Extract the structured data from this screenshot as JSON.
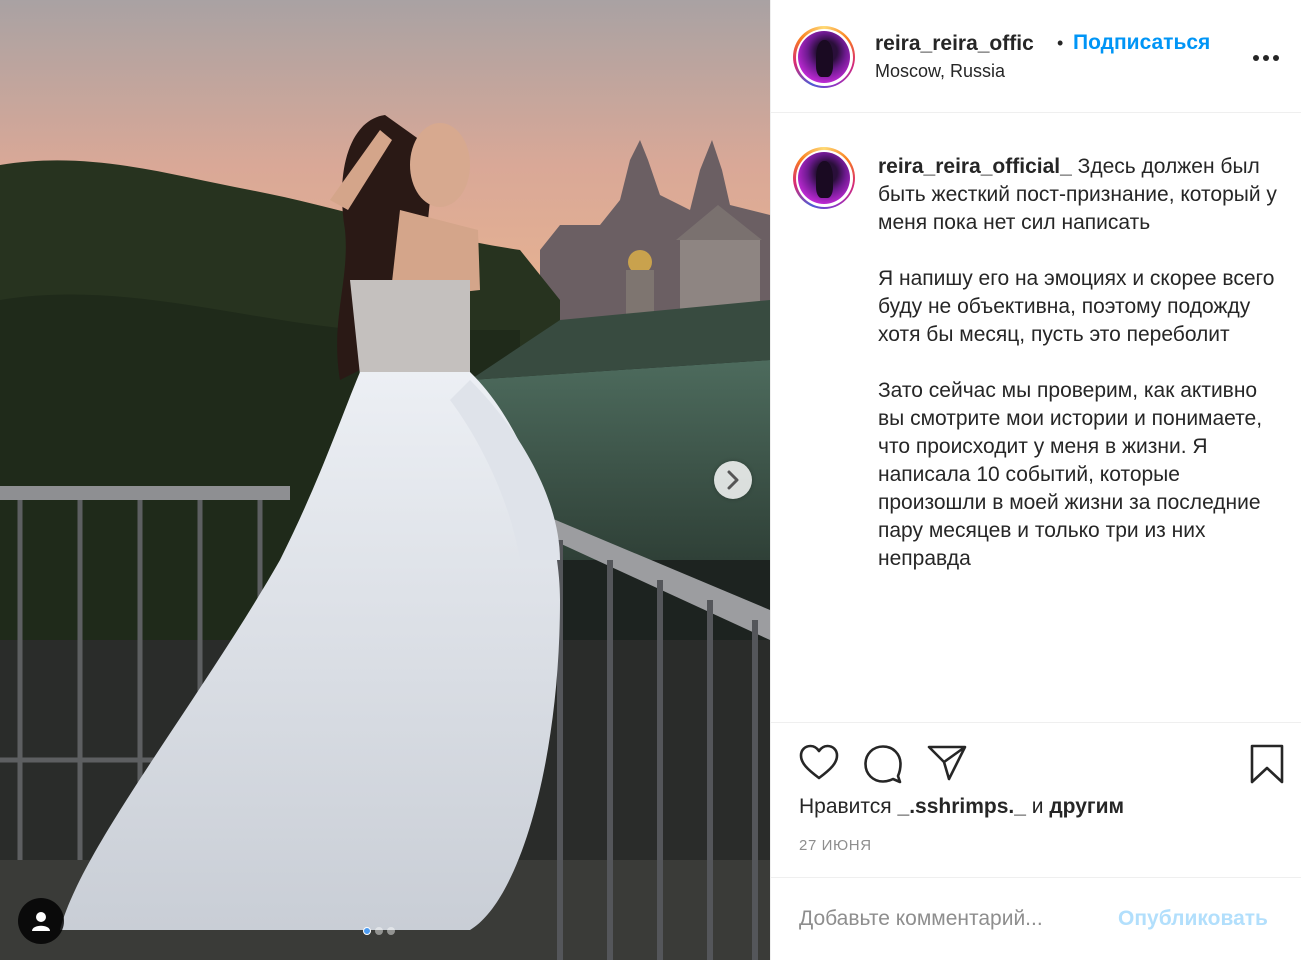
{
  "post": {
    "username": "reira_reira_offic",
    "separator": "•",
    "follow_label": "Подписаться",
    "location": "Moscow, Russia",
    "more_icon": "more-horizontal-icon"
  },
  "caption": {
    "username": "reira_reira_official_",
    "text": "Здесь должен был быть жесткий пост-признание, который у меня пока нет сил написать\n\nЯ напишу его на эмоциях и скорее всего буду не объективна, поэтому подожду хотя бы месяц, пусть это переболит\n\nЗато сейчас мы проверим, как активно вы смотрите мои истории и понимаете, что происходит у меня в жизни. Я написала 10 событий, которые произошли в моей жизни за последние пару месяцев и только три из них неправда"
  },
  "likes": {
    "prefix": "Нравится",
    "user": "_.sshrimps._",
    "conjunction": "и",
    "others": "другим"
  },
  "date": "27 ИЮНЯ",
  "comment": {
    "placeholder": "Добавьте комментарий...",
    "publish_label": "Опубликовать"
  },
  "carousel": {
    "slides": 3,
    "active_slide": 1
  },
  "colors": {
    "accent": "#0095f6",
    "publish_disabled": "#b2dffc",
    "muted": "#8e8e8e",
    "text": "#262626"
  }
}
